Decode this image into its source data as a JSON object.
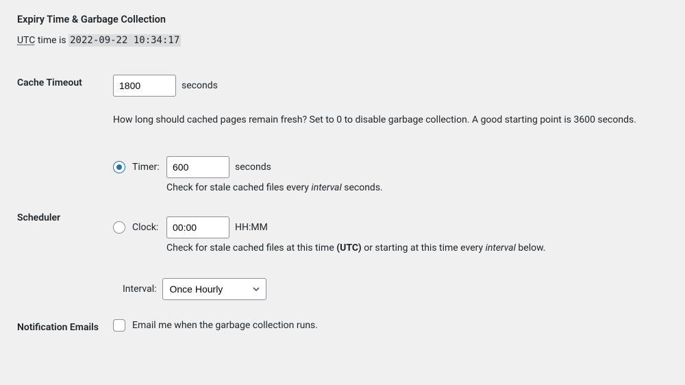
{
  "heading": "Expiry Time & Garbage Collection",
  "utc": {
    "abbr": "UTC",
    "time_is": "time is",
    "value": "2022-09-22 10:34:17"
  },
  "cache_timeout": {
    "label": "Cache Timeout",
    "value": "1800",
    "unit": "seconds",
    "description": "How long should cached pages remain fresh? Set to 0 to disable garbage collection. A good starting point is 3600 seconds."
  },
  "scheduler": {
    "label": "Scheduler",
    "timer": {
      "option_label": "Timer:",
      "value": "600",
      "unit": "seconds",
      "help_a": "Check for stale cached files every ",
      "help_em": "interval",
      "help_b": " seconds."
    },
    "clock": {
      "option_label": "Clock:",
      "value": "00:00",
      "unit": "HH:MM",
      "help_a": "Check for stale cached files at this time ",
      "help_strong": "(UTC)",
      "help_b": " or starting at this time every ",
      "help_em": "interval",
      "help_c": " below."
    },
    "interval": {
      "label": "Interval:",
      "selected": "Once Hourly"
    }
  },
  "notification": {
    "label": "Notification Emails",
    "checkbox_label": "Email me when the garbage collection runs."
  }
}
